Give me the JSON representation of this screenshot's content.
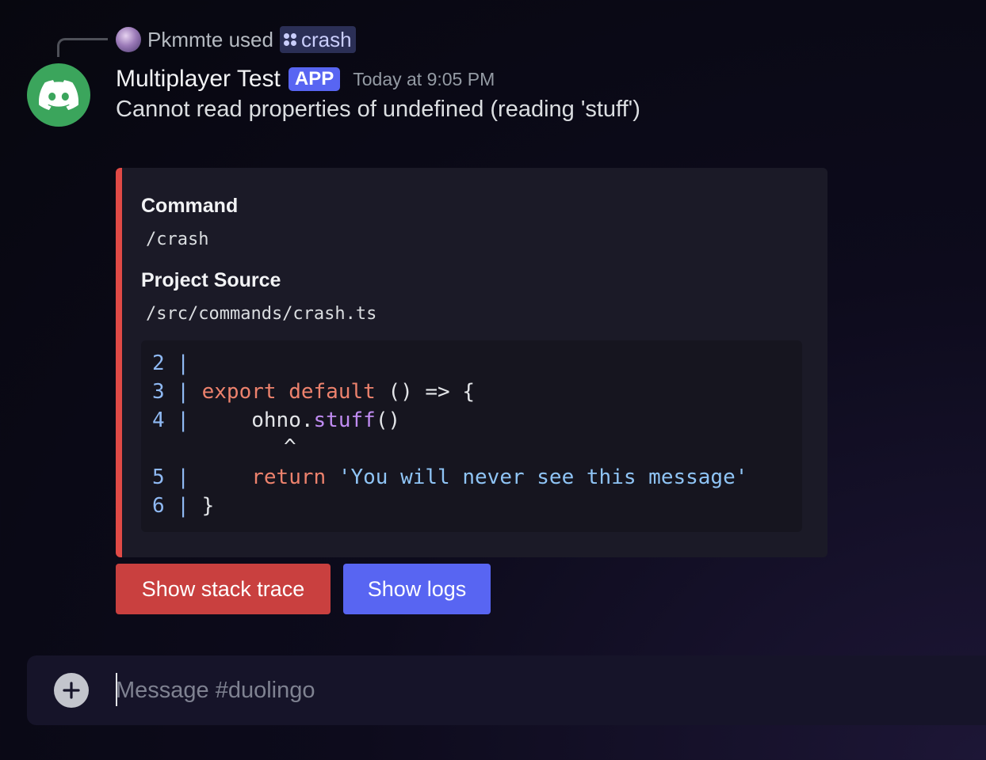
{
  "reply": {
    "user": "Pkmmte used",
    "command": "crash"
  },
  "message": {
    "username": "Multiplayer Test",
    "badge": "APP",
    "timestamp": "Today at 9:05 PM",
    "content": "Cannot read properties of undefined (reading 'stuff')"
  },
  "embed": {
    "accent_color": "#e04a46",
    "fields": [
      {
        "name": "Command",
        "value": "/crash"
      },
      {
        "name": "Project Source",
        "value": "/src/commands/crash.ts"
      }
    ],
    "code": {
      "l2": "2 |",
      "l3_num": "3 |",
      "l3_kw1": "export",
      "l3_kw2": "default",
      "l3_rest": "() => {",
      "l4_num": "4 |",
      "l4_obj": "ohno.",
      "l4_fn": "stuff",
      "l4_rest": "()",
      "caret": "^",
      "l5_num": "5 |",
      "l5_kw": "return",
      "l5_str": "'You will never see this message'",
      "l6_num": "6 |",
      "l6_rest": "}"
    }
  },
  "buttons": {
    "stack_trace": "Show stack trace",
    "logs": "Show logs"
  },
  "composer": {
    "placeholder": "Message #duolingo"
  },
  "colors": {
    "primary": "#5865f2",
    "danger": "#c9403f",
    "avatar": "#3ba55c"
  }
}
